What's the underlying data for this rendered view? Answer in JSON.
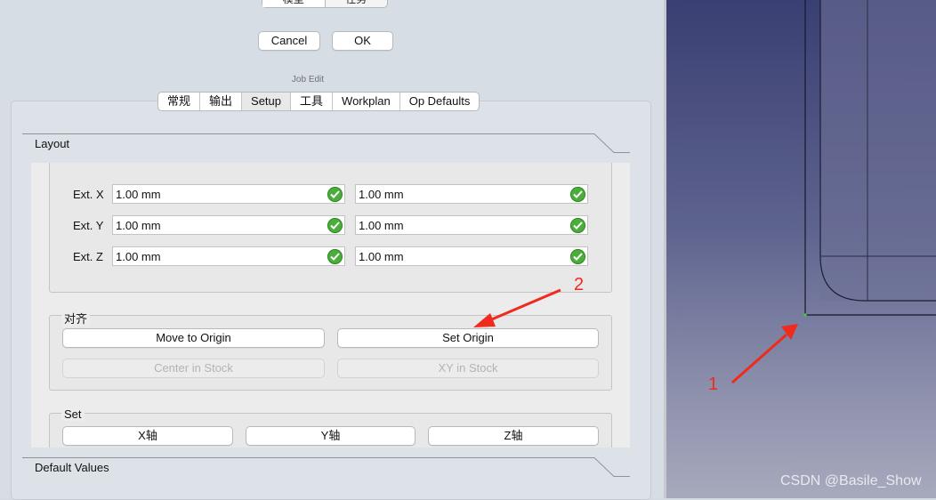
{
  "top_tabs": [
    "模型",
    "任务"
  ],
  "dialog_buttons": {
    "cancel": "Cancel",
    "ok": "OK"
  },
  "job_edit_title": "Job Edit",
  "tabs": [
    {
      "label": "常规",
      "active": false
    },
    {
      "label": "输出",
      "active": false
    },
    {
      "label": "Setup",
      "active": true
    },
    {
      "label": "工具",
      "active": false
    },
    {
      "label": "Workplan",
      "active": false
    },
    {
      "label": "Op Defaults",
      "active": false
    }
  ],
  "layout_section": {
    "title": "Layout"
  },
  "extents": [
    {
      "label": "Ext. X",
      "value1": "1.00 mm",
      "value2": "1.00 mm"
    },
    {
      "label": "Ext. Y",
      "value1": "1.00 mm",
      "value2": "1.00 mm"
    },
    {
      "label": "Ext. Z",
      "value1": "1.00 mm",
      "value2": "1.00 mm"
    }
  ],
  "align_group": {
    "title": "对齐",
    "move_to_origin": "Move to Origin",
    "set_origin": "Set Origin",
    "center_in_stock": "Center in Stock",
    "xy_in_stock": "XY in Stock"
  },
  "set_group": {
    "title": "Set",
    "x_axis": "X轴",
    "y_axis": "Y轴",
    "z_axis": "Z轴"
  },
  "default_values_section": {
    "title": "Default Values"
  },
  "annotations": {
    "arrow1": "1",
    "arrow2": "2",
    "color": "#f02a1c"
  },
  "watermark": "CSDN @Basile_Show",
  "colors": {
    "check_green": "#4cad3c"
  }
}
